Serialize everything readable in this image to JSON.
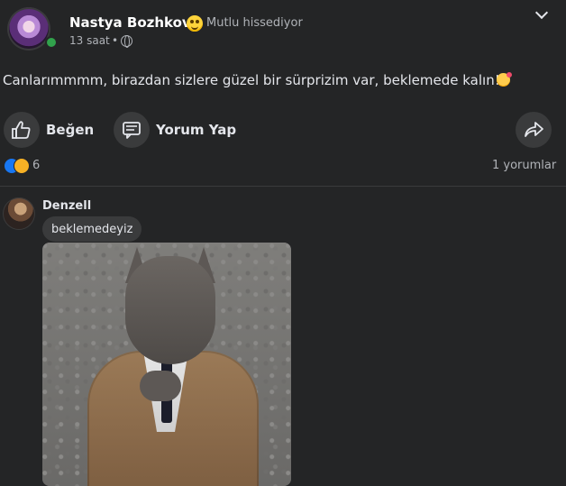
{
  "post": {
    "author": "Nastya Bozhkov",
    "feeling": "Mutlu hissediyor",
    "time": "13 saat",
    "dot": "•",
    "text": "Canlarımmmm, birazdan sizlere güzel bir sürprizim var, beklemede kalın!",
    "emoji_icon": "kiss-emoji"
  },
  "actions": {
    "like_label": "Beğen",
    "comment_label": "Yorum Yap"
  },
  "stats": {
    "reaction_count": "6",
    "comments_label": "1 yorumlar"
  },
  "comment": {
    "author": "Denzell",
    "text": "beklemedeyiz"
  },
  "colors": {
    "background": "#242526",
    "surface": "#3a3b3c",
    "online": "#31a24c",
    "like_blue": "#1877f2",
    "text_primary": "#e4e6eb",
    "text_secondary": "#b0b3b8"
  }
}
